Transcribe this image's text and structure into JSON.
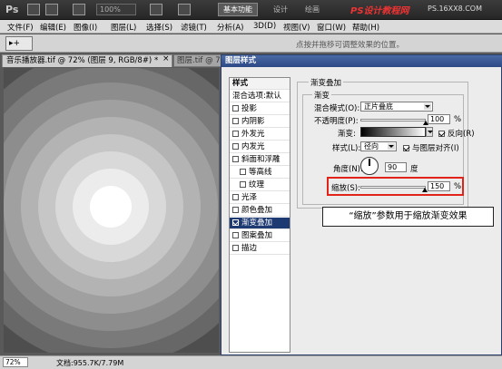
{
  "app": {
    "logo": "Ps",
    "zoom": "100%",
    "workspace": "基本功能",
    "workspace_links": [
      "设计",
      "绘画"
    ],
    "watermark": "PS设计教程网",
    "watermark_sub": "PS.16XX8.COM"
  },
  "menu": [
    "文件(F)",
    "编辑(E)",
    "图像(I)",
    "图层(L)",
    "选择(S)",
    "滤镜(T)",
    "分析(A)",
    "3D(D)",
    "视图(V)",
    "窗口(W)",
    "帮助(H)"
  ],
  "options_bar": {
    "tool_glyph": "▸+",
    "hint": "点按并拖移可调整效果的位置。"
  },
  "doc_tabs": [
    {
      "label": "音乐播放器.tif @ 72% (图层 9, RGB/8#) *",
      "close": "×"
    },
    {
      "label": "图层.tif @ 7"
    }
  ],
  "canvas": {
    "background": "radial gradient rings"
  },
  "status": {
    "zoom": "72%",
    "doc": "文档:955.7K/7.79M"
  },
  "dialog": {
    "title": "图层样式",
    "styles_header": "样式",
    "blend_options": "混合选项:默认",
    "styles": [
      {
        "label": "投影",
        "checked": false,
        "indent": false
      },
      {
        "label": "内阴影",
        "checked": false,
        "indent": false
      },
      {
        "label": "外发光",
        "checked": false,
        "indent": false
      },
      {
        "label": "内发光",
        "checked": false,
        "indent": false
      },
      {
        "label": "斜面和浮雕",
        "checked": false,
        "indent": false
      },
      {
        "label": "等高线",
        "checked": false,
        "indent": true
      },
      {
        "label": "纹理",
        "checked": false,
        "indent": true
      },
      {
        "label": "光泽",
        "checked": false,
        "indent": false
      },
      {
        "label": "颜色叠加",
        "checked": false,
        "indent": false
      },
      {
        "label": "渐变叠加",
        "checked": true,
        "indent": false,
        "selected": true
      },
      {
        "label": "图案叠加",
        "checked": false,
        "indent": false
      },
      {
        "label": "描边",
        "checked": false,
        "indent": false
      }
    ],
    "section_title": "渐变叠加",
    "group_title": "渐变",
    "blend_mode_label": "混合模式(O):",
    "blend_mode_value": "正片叠底",
    "opacity_label": "不透明度(P):",
    "opacity_value": "100",
    "opacity_unit": "%",
    "gradient_label": "渐变:",
    "reverse_label": "反向(R)",
    "reverse_checked": true,
    "style_label": "样式(L):",
    "style_value": "径向",
    "align_label": "与图层对齐(I)",
    "align_checked": true,
    "angle_label": "角度(N):",
    "angle_value": "90",
    "angle_unit": "度",
    "scale_label": "缩放(S):",
    "scale_value": "150",
    "scale_unit": "%"
  },
  "callout": "“缩放”参数用于缩放渐变效果",
  "colors": {
    "highlight": "#e2231a",
    "dialog_title": "#2c4a85",
    "selection": "#1e3a73"
  }
}
